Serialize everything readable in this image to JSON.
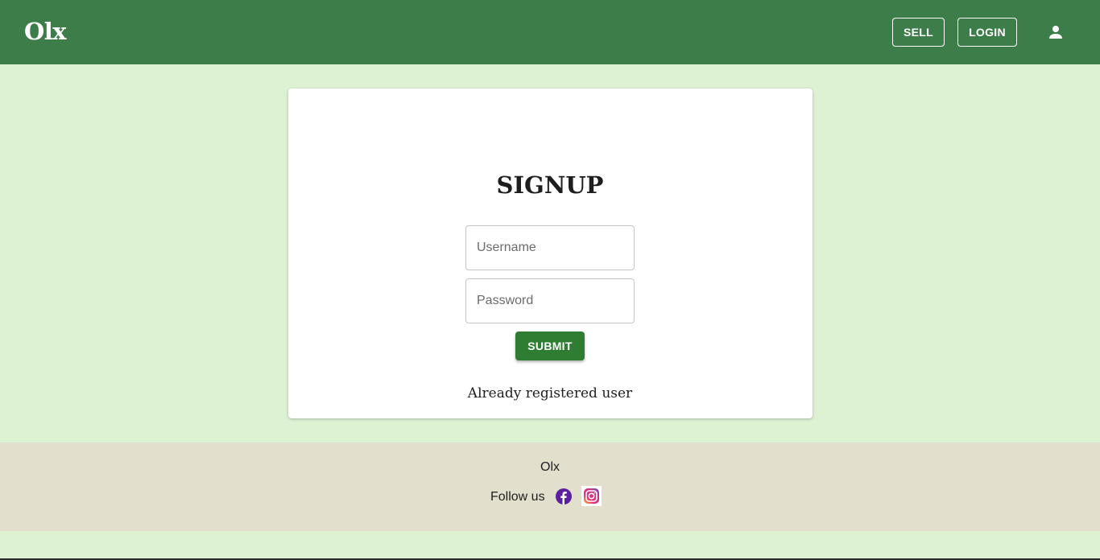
{
  "header": {
    "logo": "Olx",
    "sell_label": "SELL",
    "login_label": "LOGIN",
    "account_icon": "person-icon"
  },
  "signup": {
    "title": "SIGNUP",
    "username_placeholder": "Username",
    "password_placeholder": "Password",
    "submit_label": "SUBMIT",
    "already_registered": "Already registered user"
  },
  "footer": {
    "brand": "Olx",
    "follow_label": "Follow us",
    "social_icons": [
      "facebook-icon",
      "instagram-icon"
    ]
  },
  "colors": {
    "header_bg": "#3d7d4a",
    "page_bg": "#dcf2d3",
    "submit_bg": "#2e7d32",
    "footer_bg": "#e3dfcd",
    "facebook": "#5b1fa0"
  }
}
